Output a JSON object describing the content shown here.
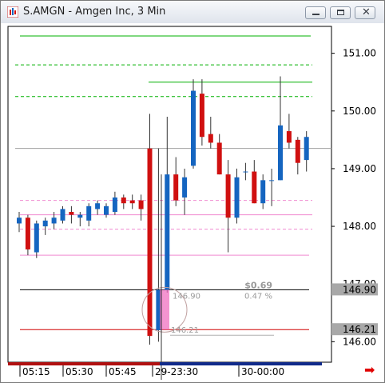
{
  "window": {
    "title": "S.AMGN - Amgen Inc, 3 Min",
    "buttons": [
      "minimize",
      "restore",
      "close"
    ]
  },
  "chart": {
    "price_axis": [
      "151.00",
      "150.00",
      "149.00",
      "148.00",
      "147.00",
      "146.00"
    ],
    "price_tags": [
      {
        "label": "146.90",
        "price": 146.9
      },
      {
        "label": "146.21",
        "price": 146.21
      }
    ],
    "time_labels": [
      "05:15",
      "05:30",
      "05:45",
      "29-23:30",
      "30-00:00"
    ],
    "annotation": {
      "change": "$0.69",
      "pct": "0.47 %",
      "high_label": "146.90",
      "low_label": "146.21"
    },
    "colors": {
      "up": "#1565c0",
      "down": "#d01010",
      "green_line": "#00b000",
      "pink_line": "#f08ad0",
      "red_line": "#d00000"
    }
  },
  "chart_data": {
    "type": "candlestick",
    "ylim": [
      145.7,
      151.3
    ],
    "candles": [
      {
        "o": 148.05,
        "h": 148.25,
        "l": 147.9,
        "c": 148.15
      },
      {
        "o": 148.15,
        "h": 148.2,
        "l": 147.5,
        "c": 147.6
      },
      {
        "o": 147.55,
        "h": 148.1,
        "l": 147.45,
        "c": 148.05
      },
      {
        "o": 148.0,
        "h": 148.15,
        "l": 147.85,
        "c": 148.1
      },
      {
        "o": 148.05,
        "h": 148.25,
        "l": 147.95,
        "c": 148.15
      },
      {
        "o": 148.1,
        "h": 148.35,
        "l": 148.05,
        "c": 148.3
      },
      {
        "o": 148.25,
        "h": 148.35,
        "l": 148.05,
        "c": 148.2
      },
      {
        "o": 148.15,
        "h": 148.25,
        "l": 148.0,
        "c": 148.2
      },
      {
        "o": 148.1,
        "h": 148.4,
        "l": 148.0,
        "c": 148.35
      },
      {
        "o": 148.3,
        "h": 148.45,
        "l": 148.2,
        "c": 148.4
      },
      {
        "o": 148.2,
        "h": 148.4,
        "l": 148.15,
        "c": 148.35
      },
      {
        "o": 148.25,
        "h": 148.6,
        "l": 148.2,
        "c": 148.5
      },
      {
        "o": 148.5,
        "h": 148.55,
        "l": 148.3,
        "c": 148.4
      },
      {
        "o": 148.45,
        "h": 148.55,
        "l": 148.3,
        "c": 148.4
      },
      {
        "o": 148.45,
        "h": 148.55,
        "l": 148.1,
        "c": 148.3
      },
      {
        "o": 149.35,
        "h": 149.95,
        "l": 145.95,
        "c": 146.1
      },
      {
        "o": 146.2,
        "h": 149.35,
        "l": 146.0,
        "c": 146.9
      },
      {
        "o": 146.9,
        "h": 149.9,
        "l": 146.85,
        "c": 148.9
      },
      {
        "o": 148.9,
        "h": 149.2,
        "l": 148.35,
        "c": 148.45
      },
      {
        "o": 148.5,
        "h": 149.0,
        "l": 148.2,
        "c": 148.85
      },
      {
        "o": 149.05,
        "h": 150.55,
        "l": 149.0,
        "c": 150.35
      },
      {
        "o": 150.3,
        "h": 150.55,
        "l": 149.4,
        "c": 149.55
      },
      {
        "o": 149.6,
        "h": 149.9,
        "l": 149.35,
        "c": 149.45
      },
      {
        "o": 149.45,
        "h": 149.6,
        "l": 148.9,
        "c": 148.9
      },
      {
        "o": 148.9,
        "h": 149.15,
        "l": 147.55,
        "c": 148.15
      },
      {
        "o": 148.15,
        "h": 149.0,
        "l": 148.05,
        "c": 148.85
      },
      {
        "o": 148.95,
        "h": 149.1,
        "l": 148.8,
        "c": 148.95
      },
      {
        "o": 148.95,
        "h": 149.15,
        "l": 148.4,
        "c": 148.4
      },
      {
        "o": 148.4,
        "h": 148.9,
        "l": 148.3,
        "c": 148.8
      },
      {
        "o": 148.8,
        "h": 149.0,
        "l": 148.35,
        "c": 148.8
      },
      {
        "o": 148.8,
        "h": 150.6,
        "l": 148.8,
        "c": 149.75
      },
      {
        "o": 149.65,
        "h": 149.95,
        "l": 149.35,
        "c": 149.45
      },
      {
        "o": 149.5,
        "h": 149.55,
        "l": 148.9,
        "c": 149.1
      },
      {
        "o": 149.15,
        "h": 149.65,
        "l": 148.95,
        "c": 149.55
      }
    ],
    "reference_lines": [
      151.3,
      150.8,
      150.5,
      150.25,
      149.35,
      148.45,
      148.2,
      147.95,
      147.5,
      146.9,
      146.21
    ]
  }
}
